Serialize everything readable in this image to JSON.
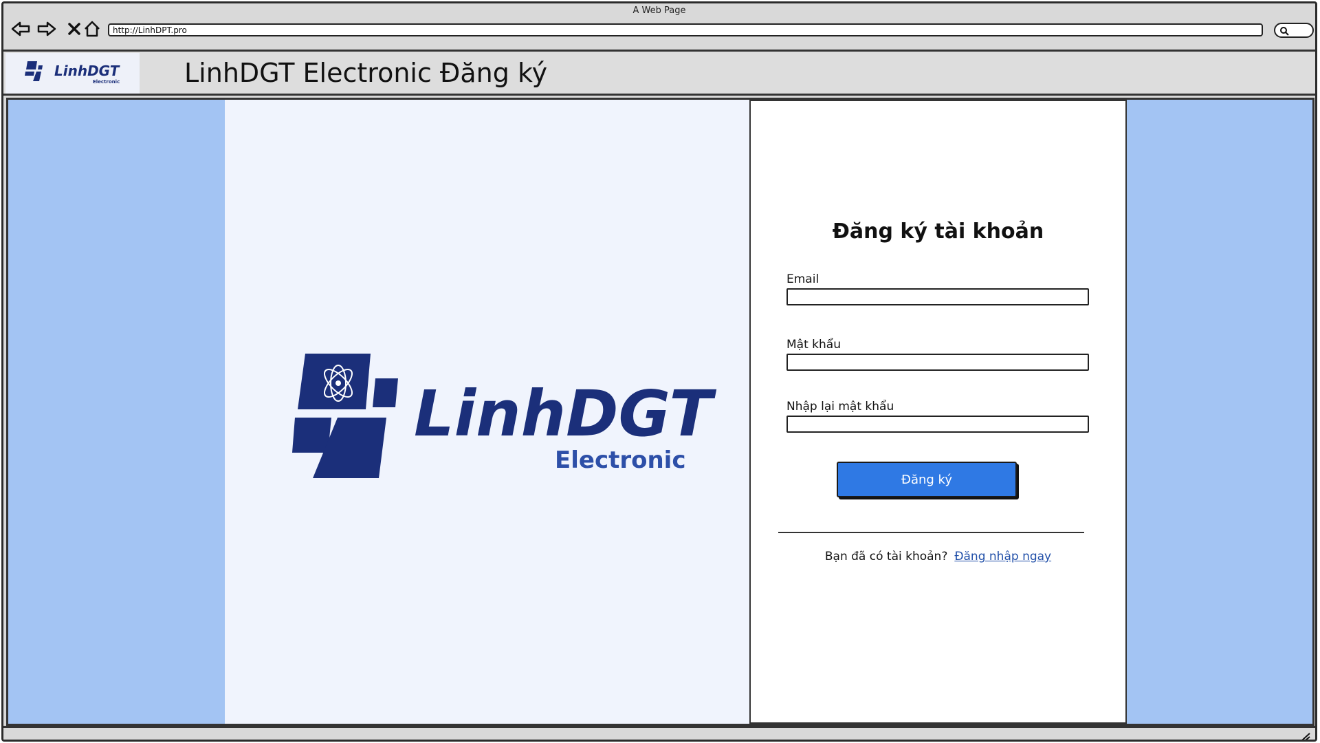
{
  "browser": {
    "window_title": "A Web Page",
    "url": "http://LinhDPT.pro",
    "nav_icons": [
      "back-arrow-icon",
      "forward-arrow-icon",
      "close-icon",
      "home-icon"
    ]
  },
  "header": {
    "logo_name": "LinhDGT",
    "logo_sub": "Electronic",
    "title": "LinhDGT Electronic Đăng ký"
  },
  "brand": {
    "name": "LinhDGT",
    "sub": "Electronic",
    "color": "#1b2f7a"
  },
  "form": {
    "title": "Đăng ký tài khoản",
    "email_label": "Email",
    "email_value": "",
    "password_label": "Mật khẩu",
    "password_value": "",
    "confirm_label": "Nhập lại mật khẩu",
    "confirm_value": "",
    "submit_label": "Đăng ký",
    "login_prompt": "Bạn đã có tài khoản?",
    "login_link": "Đăng nhập ngay"
  },
  "colors": {
    "page_background": "#a3c4f3",
    "brand_panel": "#f0f4fd",
    "primary_button": "#2f79e4",
    "link": "#1f4ea8"
  }
}
